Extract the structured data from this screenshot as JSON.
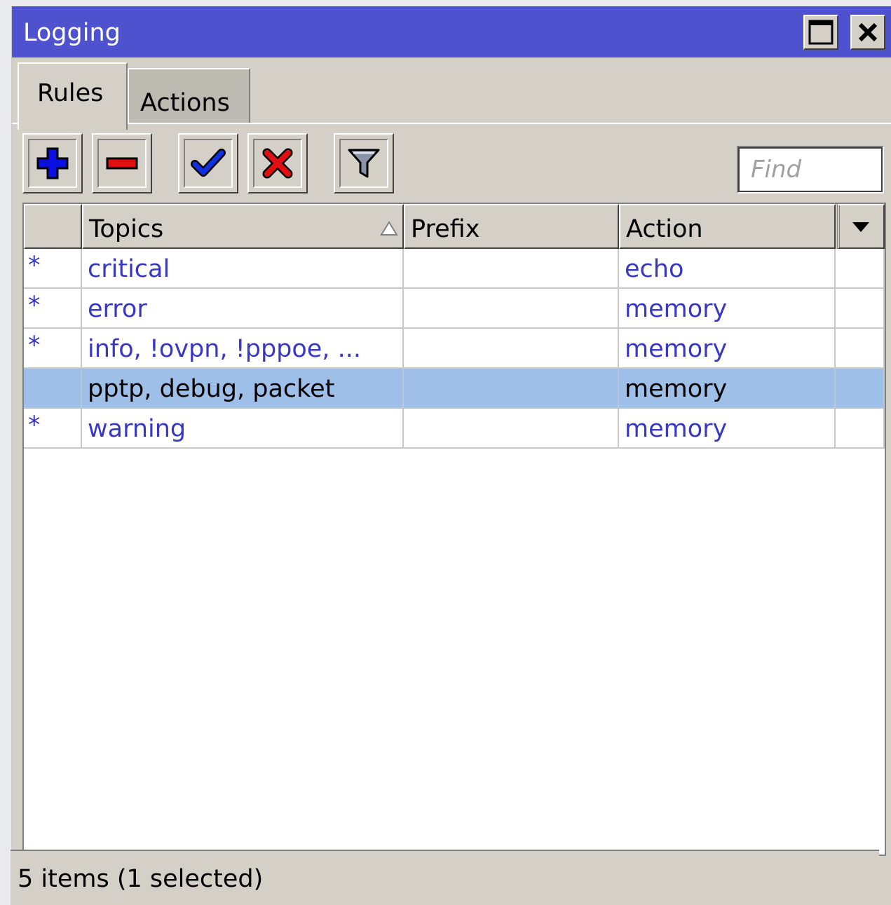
{
  "window": {
    "title": "Logging",
    "title_bar_color": "#4f52cf"
  },
  "tabs": [
    {
      "label": "Rules",
      "active": true
    },
    {
      "label": "Actions",
      "active": false
    }
  ],
  "toolbar": {
    "buttons": [
      {
        "name": "add",
        "icon": "plus-icon"
      },
      {
        "name": "remove",
        "icon": "minus-icon"
      },
      {
        "name": "enable",
        "icon": "checkmark-icon"
      },
      {
        "name": "disable",
        "icon": "x-icon"
      },
      {
        "name": "filter",
        "icon": "filter-icon"
      }
    ],
    "find_placeholder": "Find",
    "find_value": ""
  },
  "table": {
    "columns": [
      {
        "label": ""
      },
      {
        "label": "Topics",
        "sorted": "ascending"
      },
      {
        "label": "Prefix"
      },
      {
        "label": "Action"
      }
    ],
    "rows": [
      {
        "marker": "*",
        "topics": "critical",
        "prefix": "",
        "action": "echo",
        "selected": false
      },
      {
        "marker": "*",
        "topics": "error",
        "prefix": "",
        "action": "memory",
        "selected": false
      },
      {
        "marker": "*",
        "topics": "info, !ovpn, !pppoe, ...",
        "prefix": "",
        "action": "memory",
        "selected": false
      },
      {
        "marker": "",
        "topics": "pptp, debug, packet",
        "prefix": "",
        "action": "memory",
        "selected": true
      },
      {
        "marker": "*",
        "topics": "warning",
        "prefix": "",
        "action": "memory",
        "selected": false
      }
    ],
    "dynamic_text_color": "#3838c4",
    "selected_row_color": "#9ebfe8"
  },
  "status": {
    "text": "5 items (1 selected)"
  }
}
